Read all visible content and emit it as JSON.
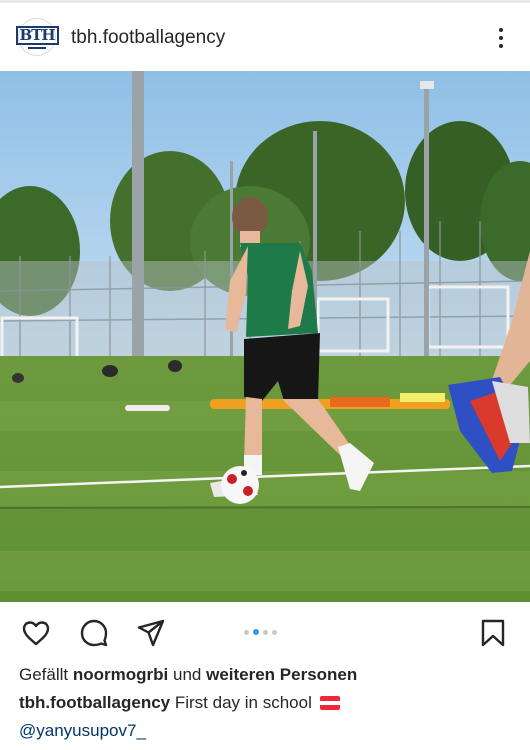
{
  "post": {
    "username": "tbh.footballagency",
    "avatar_logo_text": "BTH",
    "more_icon": "more-vertical-icon"
  },
  "actions": {
    "like_icon": "heart-icon",
    "comment_icon": "comment-icon",
    "share_icon": "send-icon",
    "save_icon": "bookmark-icon",
    "carousel_count": 4,
    "carousel_active": 2
  },
  "likes": {
    "prefix": "Gefällt",
    "user": "noormogrbi",
    "suffix": "und weiteren Personen"
  },
  "caption": {
    "username": "tbh.footballagency",
    "text": "First day in school",
    "flag": "austria-flag"
  },
  "mention": "@yanyusupov7_",
  "colors": {
    "text": "#262626",
    "link": "#00376b",
    "carousel_active": "#3897f0",
    "carousel_inactive": "#c7c7c7",
    "flag_red": "#ed2939",
    "flag_white": "#ffffff"
  }
}
